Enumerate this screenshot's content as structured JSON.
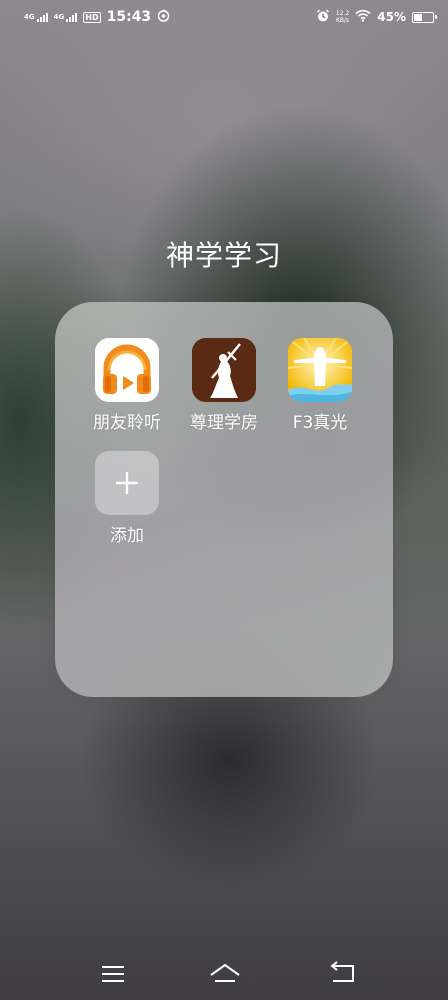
{
  "status_bar": {
    "network1": "4G",
    "network2": "4G",
    "hd_label": "HD",
    "time": "15:43",
    "speed_value": "12.2",
    "speed_unit": "KB/s",
    "battery_percent": "45%",
    "battery_level": 0.45
  },
  "folder": {
    "title": "神学学习",
    "apps": [
      {
        "label": "朋友聆听",
        "icon": "headphones-icon",
        "color": "#f28b1e"
      },
      {
        "label": "尊理学房",
        "icon": "figure-with-cross-icon",
        "color": "#5a2a14"
      },
      {
        "label": "F3真光",
        "icon": "christ-statue-icon",
        "color": "#f5c400"
      },
      {
        "label": "添加",
        "icon": "plus-icon"
      }
    ]
  },
  "nav_bar": {
    "menu": "menu-icon",
    "home": "home-icon",
    "back": "back-icon"
  }
}
